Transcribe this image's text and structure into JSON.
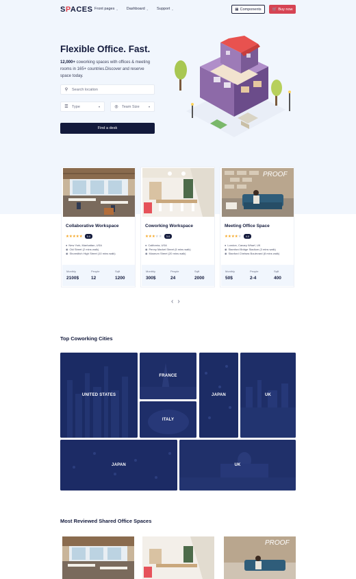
{
  "brand": {
    "logo_pre": "S",
    "logo_o": "P",
    "logo_post": "ACES"
  },
  "nav": {
    "items": [
      {
        "label": "Front pages"
      },
      {
        "label": "Dashboard"
      },
      {
        "label": "Support"
      }
    ],
    "components_label": "Components",
    "buy_label": "Buy now"
  },
  "hero": {
    "title": "Flexible Office. Fast.",
    "desc_strong": "12,000+",
    "desc_rest": " coworking spaces with offices & meeting rooms in 165+ countries.Discover and reserve space today.",
    "search_placeholder": "Search location",
    "type_placeholder": "Type",
    "team_placeholder": "Team Size",
    "find_label": "Find a desk"
  },
  "cards": [
    {
      "title": "Collaborative Workspace",
      "stars": 5,
      "badge": "5.0",
      "lines": [
        "New York, Manhattan, USA",
        "Old Street (2 mins walk)",
        "Shoreditch High Street (10 mins walk)"
      ],
      "stats": [
        {
          "label": "Monthly",
          "value": "2100$"
        },
        {
          "label": "People",
          "value": "12"
        },
        {
          "label": "Sqft",
          "value": "1200"
        }
      ]
    },
    {
      "title": "Coworking Workspace",
      "stars": 3,
      "badge": "3.0",
      "lines": [
        "California, USA",
        "Penny Market Street (5 mins walk)",
        "Museum Street (20 mins walk)"
      ],
      "stats": [
        {
          "label": "Monthly",
          "value": "300$"
        },
        {
          "label": "People",
          "value": "24"
        },
        {
          "label": "Sqft",
          "value": "2000"
        }
      ]
    },
    {
      "title": "Meeting Office Space",
      "stars": 4,
      "badge": "4.0",
      "lines": [
        "London, Canary Wharf, UK",
        "Stamford Bridge Stadium (3 mins walk)",
        "Stanford Chelsea Boulevard (8 mins walk)"
      ],
      "stats": [
        {
          "label": "Monthly",
          "value": "50$"
        },
        {
          "label": "People",
          "value": "2-4"
        },
        {
          "label": "Sqft",
          "value": "400"
        }
      ]
    }
  ],
  "cities_title": "Top Coworking Cities",
  "cities": [
    {
      "name": "UNITED STATES"
    },
    {
      "name": "FRANCE"
    },
    {
      "name": "ITALY"
    },
    {
      "name": "JAPAN"
    },
    {
      "name": "UK"
    },
    {
      "name": "JAPAN"
    },
    {
      "name": "UK"
    }
  ],
  "reviewed_title": "Most Reviewed Shared Office Spaces",
  "photo_sign": "PROOF",
  "colors": {
    "navy": "#131a3c",
    "accent": "#d64453",
    "hero_bg": "#f1f6fd",
    "star": "#f5a623"
  }
}
